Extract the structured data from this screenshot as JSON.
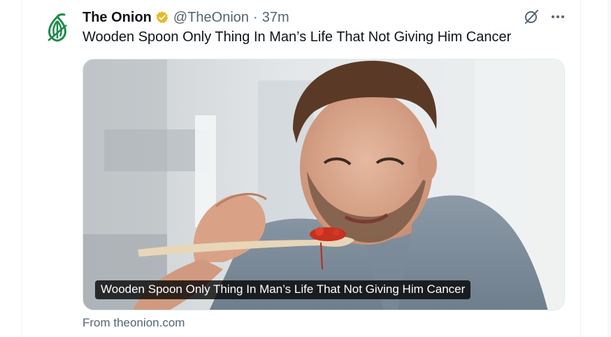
{
  "tweet": {
    "display_name": "The Onion",
    "handle": "@TheOnion",
    "separator": "·",
    "time": "37m",
    "text": "Wooden Spoon Only Thing In Man’s Life That Not Giving Him Cancer",
    "verified_badge_color": "#e8b829",
    "avatar_icon": "onion-logo-icon",
    "avatar_color": "#1f8a4c"
  },
  "card": {
    "caption": "Wooden Spoon Only Thing In Man’s Life That Not Giving Him Cancer",
    "source": "From theonion.com",
    "image_description_icon": "photo-man-tasting-sauce-from-wooden-spoon"
  },
  "actions": {
    "grok_icon": "grok-icon",
    "more_icon": "more-options-icon"
  }
}
